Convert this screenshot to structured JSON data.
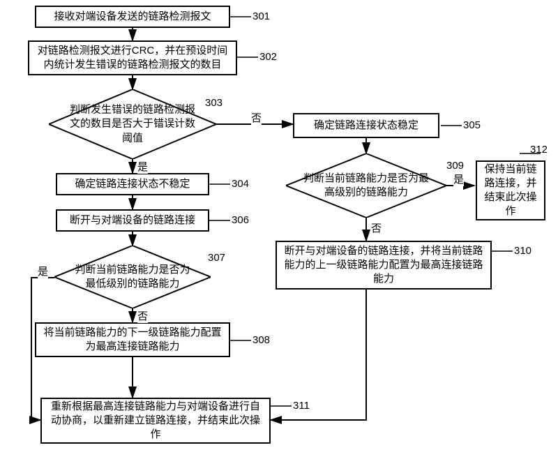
{
  "chart_data": {
    "type": "flowchart",
    "title": "",
    "nodes": [
      {
        "id": "301",
        "shape": "rect",
        "text": "接收对端设备发送的链路检测报文"
      },
      {
        "id": "302",
        "shape": "rect",
        "text": "对链路检测报文进行CRC，并在预设时间内统计发生错误的链路检测报文的数目"
      },
      {
        "id": "303",
        "shape": "diamond",
        "text": "判断发生错误的链路检测报文的数目是否大于错误计数阈值"
      },
      {
        "id": "304",
        "shape": "rect",
        "text": "确定链路连接状态不稳定"
      },
      {
        "id": "305",
        "shape": "rect",
        "text": "确定链路连接状态稳定"
      },
      {
        "id": "306",
        "shape": "rect",
        "text": "断开与对端设备的链路连接"
      },
      {
        "id": "307",
        "shape": "diamond",
        "text": "判断当前链路能力是否为最低级别的链路能力"
      },
      {
        "id": "308",
        "shape": "rect",
        "text": "将当前链路能力的下一级链路能力配置为最高连接链路能力"
      },
      {
        "id": "309",
        "shape": "diamond",
        "text": "判断当前链路能力是否为最高级别的链路能力"
      },
      {
        "id": "310",
        "shape": "rect",
        "text": "断开与对端设备的链路连接，并将当前链路能力的上一级链路能力配置为最高连接链路能力"
      },
      {
        "id": "311",
        "shape": "rect",
        "text": "重新根据最高连接链路能力与对端设备进行自动协商，以重新建立链路连接，并结束此次操作"
      },
      {
        "id": "312",
        "shape": "rect",
        "text": "保持当前链路连接，并结束此次操作"
      }
    ],
    "edges": [
      {
        "from": "301",
        "to": "302"
      },
      {
        "from": "302",
        "to": "303"
      },
      {
        "from": "303",
        "to": "304",
        "label": "是"
      },
      {
        "from": "303",
        "to": "305",
        "label": "否"
      },
      {
        "from": "304",
        "to": "306"
      },
      {
        "from": "305",
        "to": "309"
      },
      {
        "from": "306",
        "to": "307"
      },
      {
        "from": "307",
        "to": "308",
        "label": "否"
      },
      {
        "from": "307",
        "to": "311",
        "label": "是"
      },
      {
        "from": "308",
        "to": "311"
      },
      {
        "from": "309",
        "to": "310",
        "label": "否"
      },
      {
        "from": "309",
        "to": "312",
        "label": "是"
      },
      {
        "from": "310",
        "to": "311"
      }
    ]
  },
  "labels": {
    "yes": "是",
    "no": "否"
  },
  "n301": "接收对端设备发送的链路检测报文",
  "r301": "301",
  "n302": "对链路检测报文进行CRC，并在预设时间内统计发生错误的链路检测报文的数目",
  "r302": "302",
  "n303": "判断发生错误的链路检测报文的数目是否大于错误计数阈值",
  "r303": "303",
  "n304": "确定链路连接状态不稳定",
  "r304": "304",
  "n305": "确定链路连接状态稳定",
  "r305": "305",
  "n306": "断开与对端设备的链路连接",
  "r306": "306",
  "n307": "判断当前链路能力是否为最低级别的链路能力",
  "r307": "307",
  "n308": "将当前链路能力的下一级链路能力配置为最高连接链路能力",
  "r308": "308",
  "n309": "判断当前链路能力是否为最高级别的链路能力",
  "r309": "309",
  "n310": "断开与对端设备的链路连接，并将当前链路能力的上一级链路能力配置为最高连接链路能力",
  "r310": "310",
  "n311": "重新根据最高连接链路能力与对端设备进行自动协商，以重新建立链路连接，并结束此次操作",
  "r311": "311",
  "n312": "保持当前链路连接，并结束此次操作",
  "r312": "312"
}
